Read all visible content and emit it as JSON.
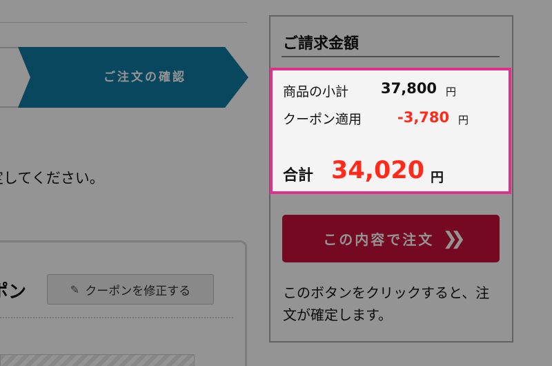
{
  "progress": {
    "current_step_label": "ご注文の確認"
  },
  "main": {
    "instruction_text": "定してください。",
    "coupon_section_title": "ポン",
    "edit_coupon_button_label": "クーポンを修正する"
  },
  "summary": {
    "title": "ご請求金額",
    "subtotal_label": "商品の小計",
    "subtotal_value": "37,800",
    "subtotal_unit": "円",
    "coupon_label": "クーポン適用",
    "coupon_value": "-3,780",
    "coupon_unit": "円",
    "total_label": "合計",
    "total_value": "34,020",
    "total_unit": "円",
    "order_button_label": "この内容で注文",
    "help_text": "このボタンをクリックすると、注文が確定します。"
  },
  "colors": {
    "accent_blue": "#0e7aa3",
    "order_red": "#c8113a",
    "price_red": "#ff2a1a",
    "highlight_pink": "#e22f8c"
  },
  "icons": {
    "pencil": "pencil-icon",
    "double_chevron": "double-chevron-right-icon"
  }
}
